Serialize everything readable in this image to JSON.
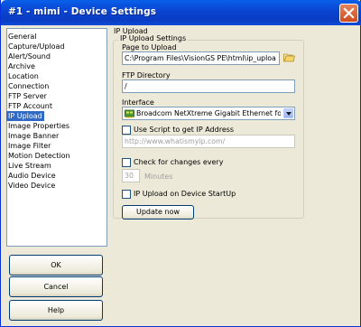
{
  "window": {
    "title": "#1 - mimi - Device Settings"
  },
  "nav": {
    "items": [
      {
        "label": "General"
      },
      {
        "label": "Capture/Upload"
      },
      {
        "label": "Alert/Sound"
      },
      {
        "label": "Archive"
      },
      {
        "label": "Location"
      },
      {
        "label": "Connection"
      },
      {
        "label": "FTP Server"
      },
      {
        "label": "FTP Account"
      },
      {
        "label": "IP Upload",
        "selected": true
      },
      {
        "label": "Image Properties"
      },
      {
        "label": "Image Banner"
      },
      {
        "label": "Image Filter"
      },
      {
        "label": "Motion Detection"
      },
      {
        "label": "Live Stream"
      },
      {
        "label": "Audio Device"
      },
      {
        "label": "Video Device"
      }
    ]
  },
  "buttons": {
    "ok": "OK",
    "cancel": "Cancel",
    "help": "Help"
  },
  "panel": {
    "title": "IP Upload",
    "group_label": "IP Upload Settings",
    "page_to_upload_label": "Page to  Upload",
    "page_to_upload_value": "C:\\Program Files\\VisionGS PE\\html\\ip_uploa",
    "ftp_directory_label": "FTP Directory",
    "ftp_directory_value": "/",
    "interface_label": "Interface",
    "interface_value": "Broadcom NetXtreme Gigabit Ethernet for hp -",
    "use_script_label": "Use Script to get IP Address",
    "script_url_value": "http://www.whatismyip.com/",
    "check_changes_label": "Check for changes every",
    "check_interval_value": "30",
    "minutes_label": "Minutes",
    "upload_on_startup_label": "IP Upload on Device StartUp",
    "update_now_label": "Update now"
  }
}
